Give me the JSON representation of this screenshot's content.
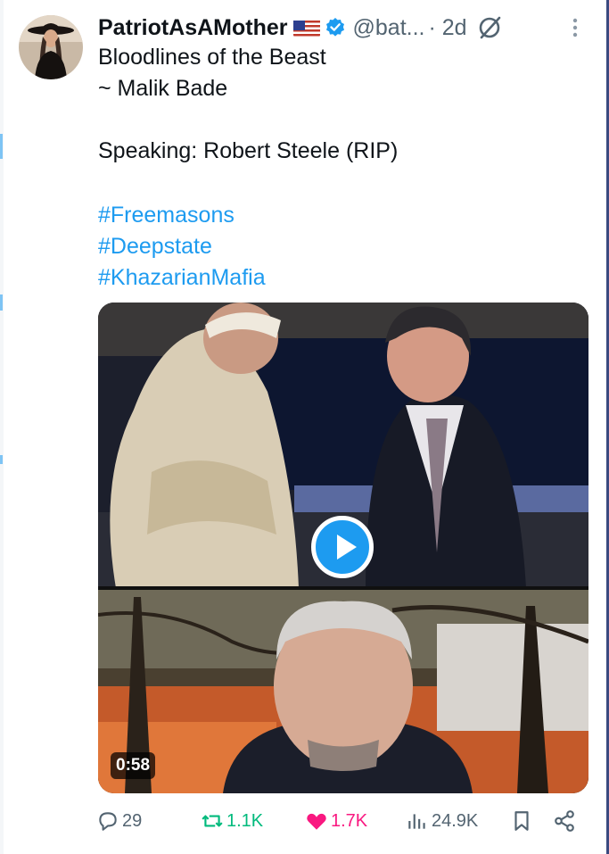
{
  "tweet": {
    "author": {
      "display_name": "PatriotAsAMother",
      "flag_emoji": "us-flag",
      "verified_icon": "verified-badge-icon",
      "handle": "@bat...",
      "time": "· 2d"
    },
    "text_lines": [
      "Bloodlines of the Beast",
      "~ Malik Bade",
      "Speaking: Robert Steele (RIP)"
    ],
    "hashtags": [
      "#Freemasons",
      "#Deepstate",
      "#KhazarianMafia"
    ],
    "media": {
      "duration": "0:58",
      "play_icon": "play-icon"
    },
    "actions": {
      "replies": "29",
      "reposts": "1.1K",
      "likes": "1.7K",
      "views": "24.9K"
    },
    "colors": {
      "accent": "#1d9bf0",
      "repost": "#00ba7c",
      "like": "#f91880",
      "muted": "#536471"
    }
  }
}
